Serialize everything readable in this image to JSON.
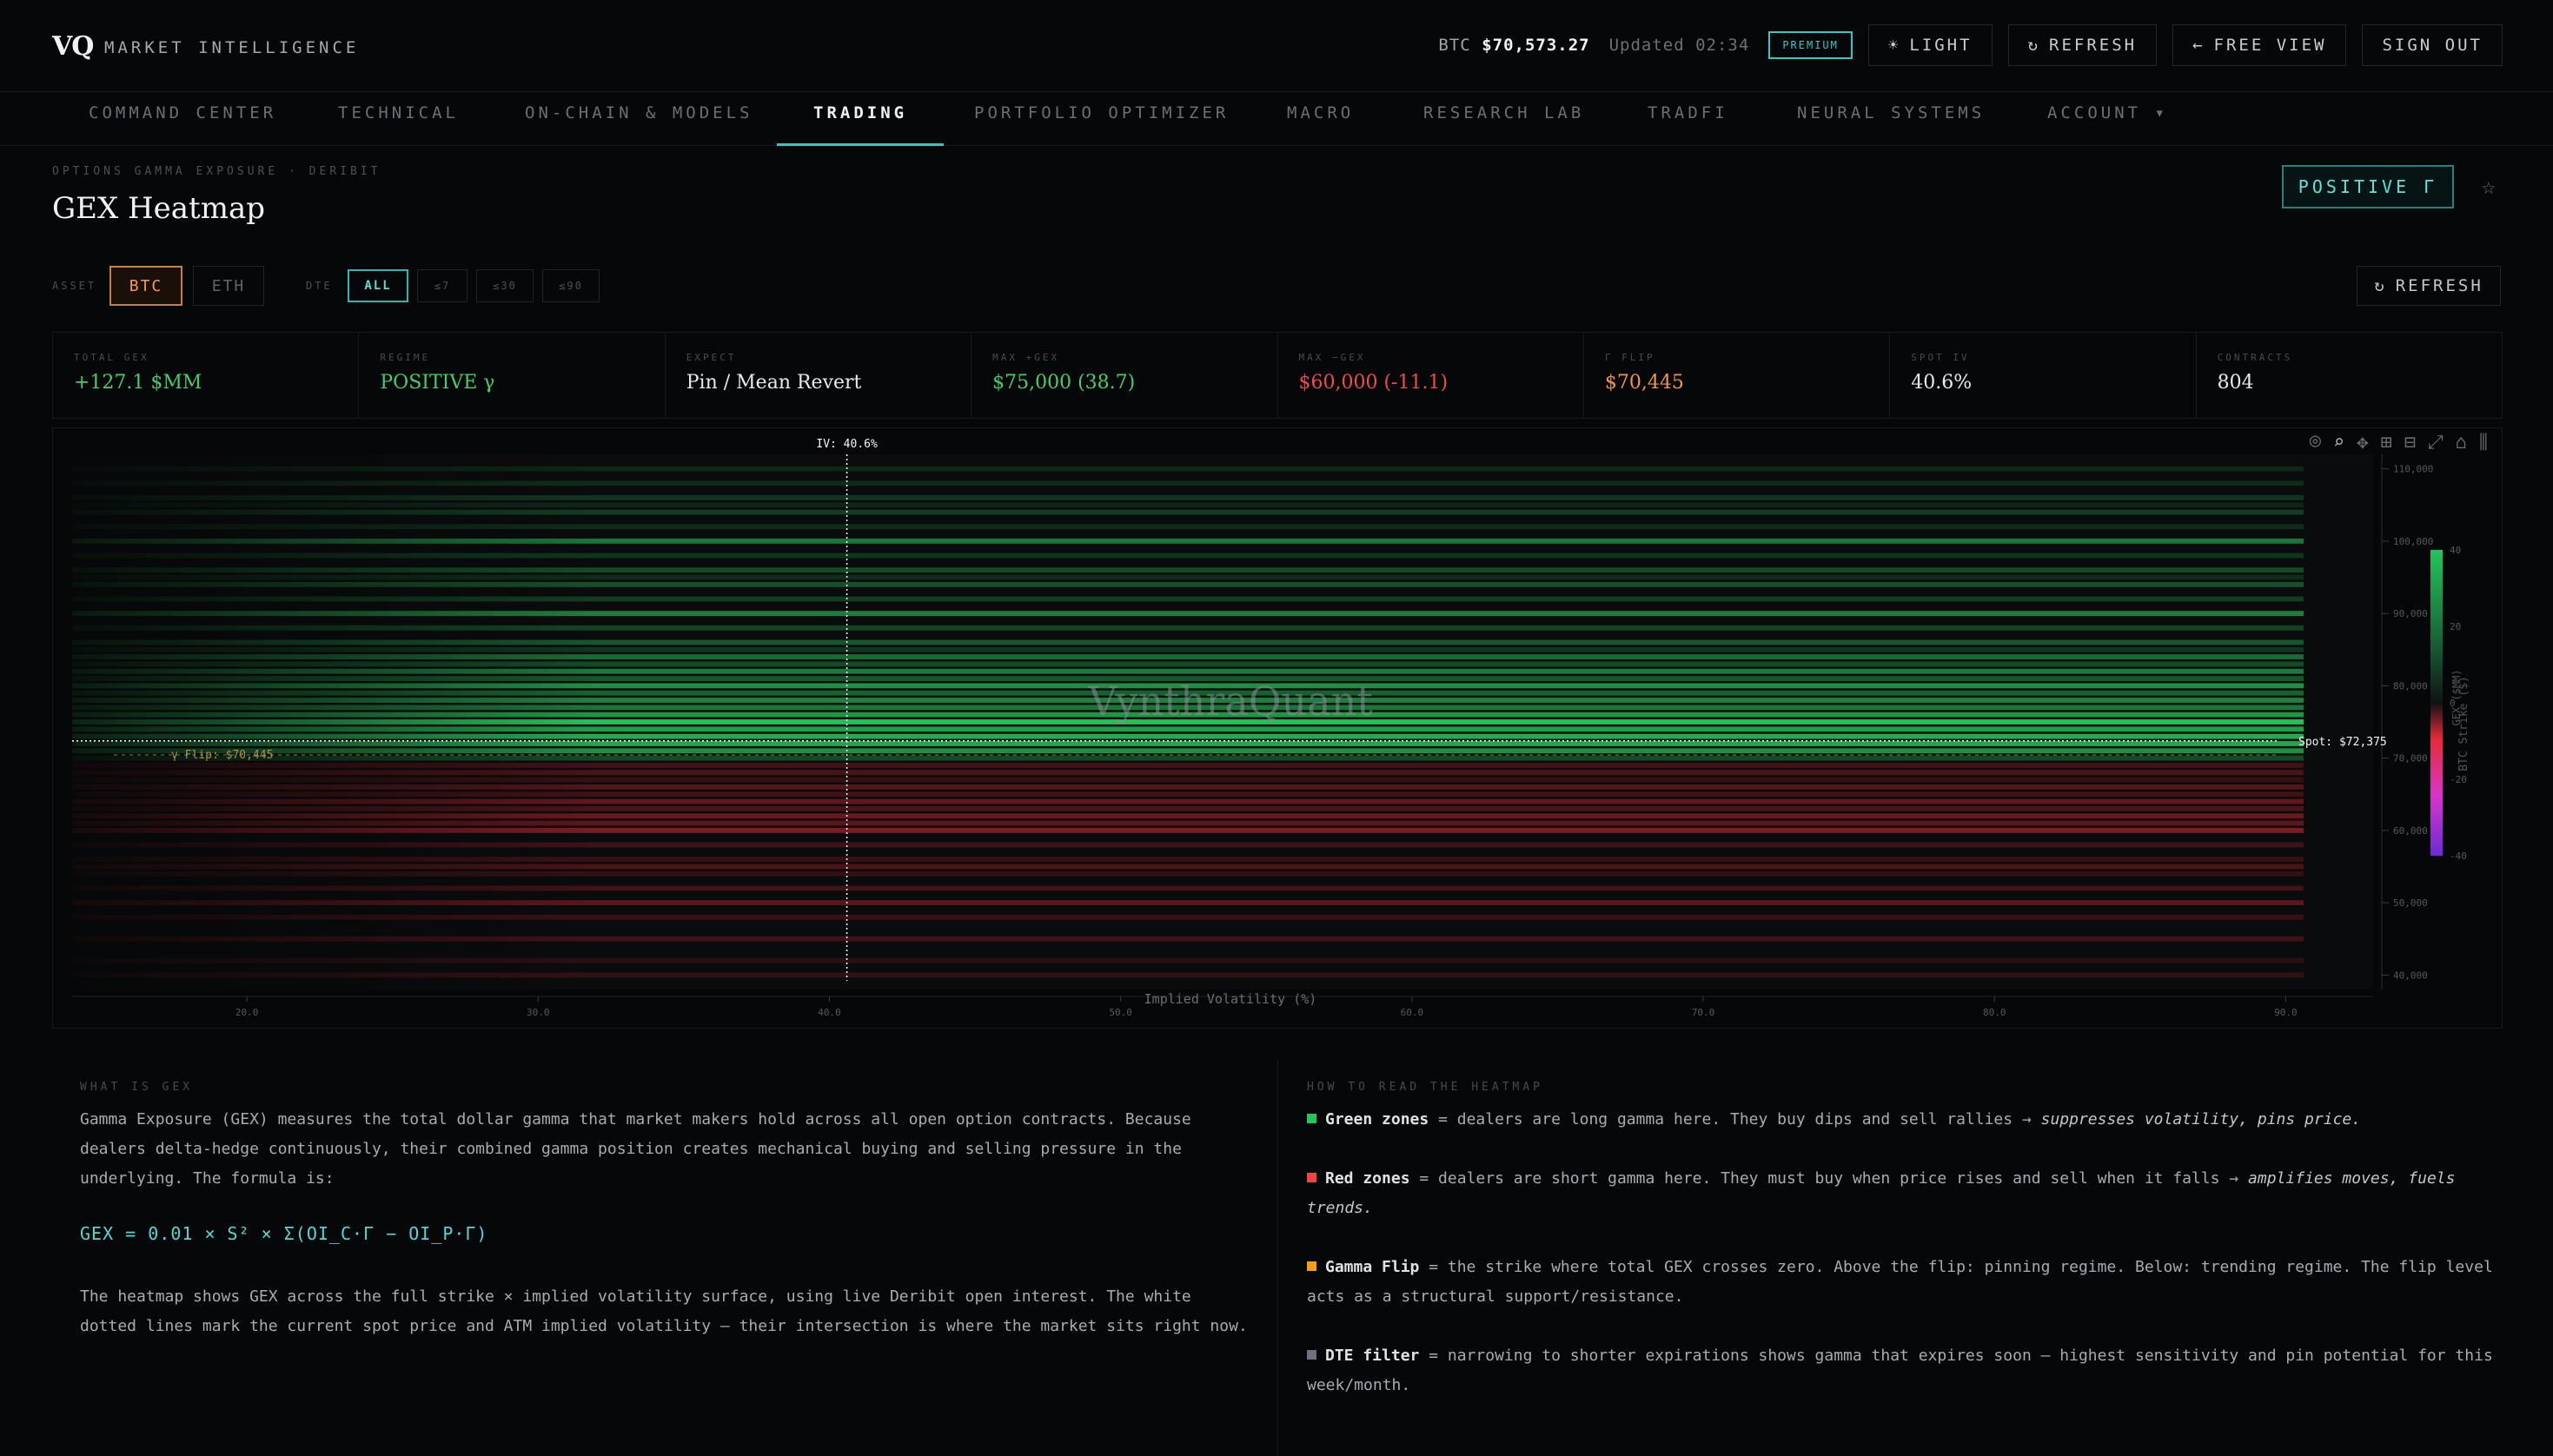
{
  "header": {
    "logo": "VQ",
    "brand": "MARKET INTELLIGENCE",
    "price_label": "BTC",
    "price_value": "$70,573.27",
    "updated": "Updated 02:34",
    "premium": "PREMIUM",
    "light_btn": "LIGHT",
    "refresh_btn": "REFRESH",
    "free_view_btn": "FREE VIEW",
    "sign_out_btn": "SIGN OUT"
  },
  "nav": [
    {
      "label": "COMMAND CENTER"
    },
    {
      "label": "TECHNICAL"
    },
    {
      "label": "ON-CHAIN & MODELS"
    },
    {
      "label": "TRADING"
    },
    {
      "label": "PORTFOLIO OPTIMIZER"
    },
    {
      "label": "MACRO"
    },
    {
      "label": "RESEARCH LAB"
    },
    {
      "label": "TRADFI"
    },
    {
      "label": "NEURAL SYSTEMS"
    },
    {
      "label": "ACCOUNT ▾"
    }
  ],
  "page": {
    "kicker": "OPTIONS GAMMA EXPOSURE · DERIBIT",
    "title": "GEX Heatmap",
    "regime_badge": "POSITIVE Γ",
    "star": "☆"
  },
  "filters": {
    "asset_label": "ASSET",
    "assets": [
      "BTC",
      "ETH"
    ],
    "dte_label": "DTE",
    "dte": [
      "ALL",
      "≤7",
      "≤30",
      "≤90"
    ],
    "refresh": "REFRESH"
  },
  "stats": [
    {
      "label": "TOTAL GEX",
      "value": "+127.1 $MM",
      "color": "#3fcf6e"
    },
    {
      "label": "REGIME",
      "value": "POSITIVE γ",
      "color": "#3fcf6e"
    },
    {
      "label": "EXPECT",
      "value": "Pin / Mean Revert",
      "color": "#e7e9eb"
    },
    {
      "label": "MAX +GEX",
      "value": "$75,000 (38.7)",
      "color": "#3fcf6e"
    },
    {
      "label": "MAX −GEX",
      "value": "$60,000 (-11.1)",
      "color": "#f04a4a"
    },
    {
      "label": "Γ FLIP",
      "value": "$70,445",
      "color": "#f0963c"
    },
    {
      "label": "SPOT IV",
      "value": "40.6%",
      "color": "#e7e9eb"
    },
    {
      "label": "CONTRACTS",
      "value": "804",
      "color": "#e7e9eb"
    }
  ],
  "chart_data": {
    "type": "heatmap",
    "xlabel": "Implied Volatility (%)",
    "ylabel": "BTC Strike ($)",
    "colorbar_title": "GEX ($MM)",
    "xlim": [
      14,
      93
    ],
    "ylim": [
      38000,
      112000
    ],
    "xticks": [
      "20.0",
      "30.0",
      "40.0",
      "50.0",
      "60.0",
      "70.0",
      "80.0",
      "90.0"
    ],
    "xtick_values": [
      20,
      30,
      40,
      50,
      60,
      70,
      80,
      90
    ],
    "yticks": [
      "110,000",
      "100,000",
      "90,000",
      "80,000",
      "70,000",
      "60,000",
      "50,000",
      "40,000"
    ],
    "ytick_values": [
      110000,
      100000,
      90000,
      80000,
      70000,
      60000,
      50000,
      40000
    ],
    "colorbar_ticks": [
      "40",
      "20",
      "0",
      "-20",
      "-40"
    ],
    "colorbar_values": [
      40,
      20,
      0,
      -20,
      -40
    ],
    "spot_label": "Spot: $72,375",
    "spot": 72375,
    "iv_label": "IV: 40.6%",
    "iv": 40.6,
    "flip_label": "γ Flip: $70,445",
    "flip": 70445,
    "watermark": "VynthraQuant",
    "colors": {
      "positive": "#27c95c",
      "negative": "#ff2a3a",
      "magenta": "#e236d8",
      "violet": "#6b2bd8"
    },
    "strikes": [
      110000,
      108000,
      106000,
      105000,
      104000,
      102000,
      100000,
      98000,
      96000,
      95000,
      94000,
      92000,
      90000,
      88000,
      86000,
      85000,
      84000,
      83000,
      82000,
      81000,
      80000,
      79000,
      78000,
      77000,
      76000,
      75000,
      74000,
      73000,
      72000,
      71000,
      70000,
      69000,
      68000,
      67000,
      66000,
      65000,
      64000,
      63000,
      62000,
      61000,
      60000,
      58000,
      56000,
      55000,
      54000,
      52000,
      50000,
      48000,
      45000,
      42000,
      40000
    ],
    "gex": [
      1.5,
      2,
      3,
      1.5,
      4,
      2,
      14,
      3,
      6,
      2,
      7,
      4,
      16,
      5,
      8,
      3,
      12,
      6,
      15,
      8,
      20,
      10,
      17,
      14,
      22,
      38.7,
      24,
      28,
      26,
      20,
      6,
      -3,
      -4,
      -2,
      -5,
      -3,
      -7,
      -4,
      -8,
      -6,
      -11.1,
      -3,
      -2.5,
      -4,
      -2,
      -3,
      -6,
      -2.5,
      -3,
      -1.5,
      -2
    ]
  },
  "what_is": {
    "title": "WHAT IS GEX",
    "para1": [
      "Gamma Exposure (GEX) measures the total dollar gamma that market makers hold across all open option contracts. Because",
      "dealers delta-hedge continuously, their combined gamma position creates mechanical buying and selling pressure in the",
      "underlying. The formula is:"
    ],
    "formula": "GEX = 0.01 × S² × Σ(OI_C·Γ − OI_P·Γ)",
    "para2": [
      "The heatmap shows GEX across the full strike × implied volatility surface, using live Deribit open interest. The white",
      "dotted lines mark the current spot price and ATM implied volatility — their intersection is where the market sits right now."
    ]
  },
  "how_to": {
    "title": "HOW TO READ THE HEATMAP",
    "items": [
      {
        "color": "#22c55e",
        "term": "Green zones",
        "text": " = dealers are long gamma here. They buy dips and sell rallies → ",
        "em": "suppresses volatility, pins price."
      },
      {
        "color": "#ef4444",
        "term": "Red zones",
        "text": " = dealers are short gamma here. They must buy when price rises and sell when it falls → ",
        "em": "amplifies moves, fuels trends."
      },
      {
        "color": "#f59e0b",
        "term": "Gamma Flip",
        "text": " = the strike where total GEX crosses zero. Above the flip: pinning regime. Below: trending regime. The flip level acts as a structural support/resistance.",
        "em": ""
      },
      {
        "color": "#6b7280",
        "term": "DTE filter",
        "text": " = narrowing to shorter expirations shows gamma that expires soon — highest sensitivity and pin potential for this week/month.",
        "em": ""
      }
    ]
  }
}
